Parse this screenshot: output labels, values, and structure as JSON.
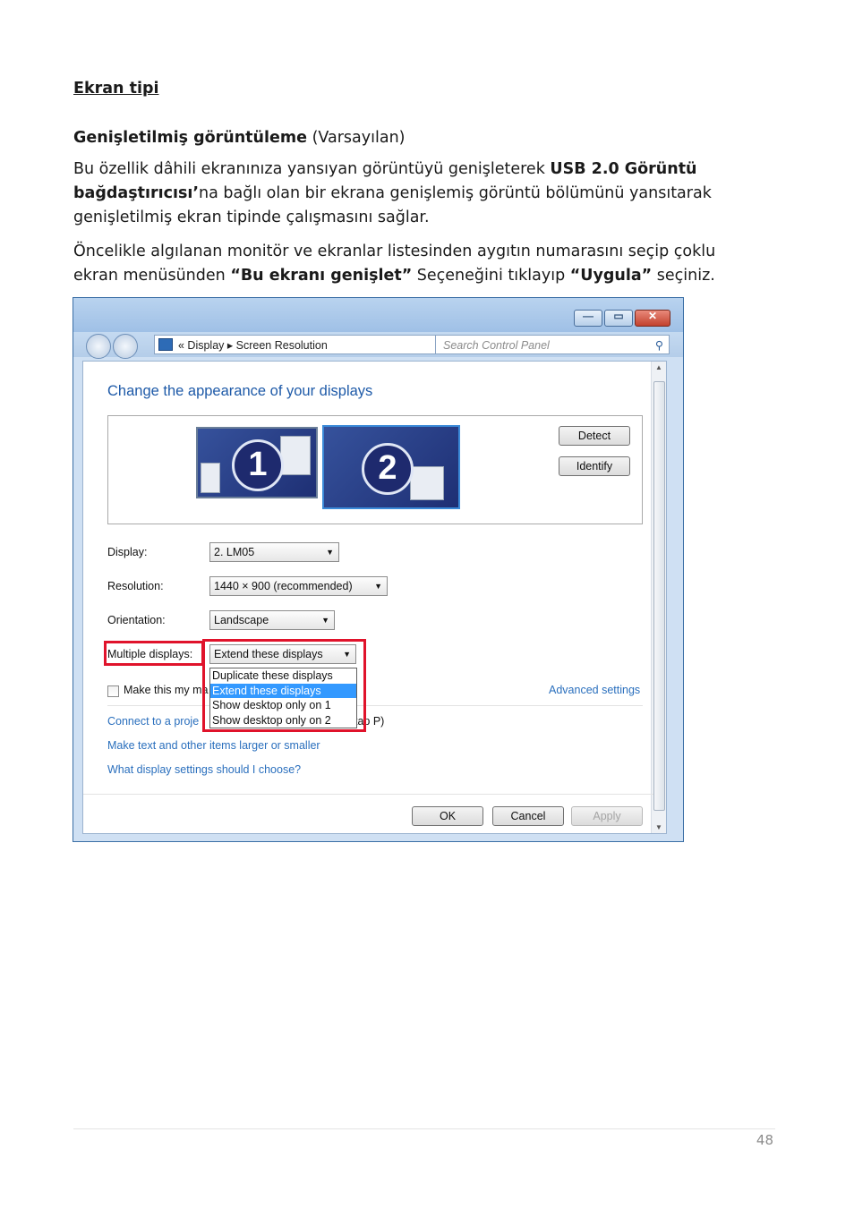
{
  "document": {
    "section_title": "Ekran tipi",
    "subheading_bold": "Genişletilmiş görüntüleme",
    "subheading_rest": "(Varsayılan)",
    "p1_a": "Bu özellik dâhili ekranınıza yansıyan görüntüyü genişleterek",
    "p1_b": "USB 2.0 Görüntü bağdaştırıcısı’",
    "p1_c": "na bağlı olan bir ekrana genişlemiş görüntü bölümünü yansıtarak genişletilmiş ekran tipinde çalışmasını sağlar.",
    "p2_a": "Öncelikle algılanan monitör ve ekranlar listesinden aygıtın numarasını seçip çoklu ekran menüsünden",
    "p2_b": "“Bu ekranı genişlet”",
    "p2_c": "Seçeneğini tıklayıp",
    "p2_d": "“Uygula”",
    "p2_e": "seçiniz.",
    "page_number": "48"
  },
  "window": {
    "breadcrumb": "«  Display  ▸  Screen Resolution",
    "search_placeholder": "Search Control Panel",
    "page_title": "Change the appearance of your displays",
    "monitor_1": "1",
    "monitor_2": "2",
    "detect": "Detect",
    "identify": "Identify",
    "display_label": "Display:",
    "display_value": "2. LM05",
    "resolution_label": "Resolution:",
    "resolution_value": "1440 × 900 (recommended)",
    "orientation_label": "Orientation:",
    "orientation_value": "Landscape",
    "multiple_label": "Multiple displays:",
    "multiple_value": "Extend these displays",
    "options": [
      "Duplicate these displays",
      "Extend these displays",
      "Show desktop only on 1",
      "Show desktop only on 2"
    ],
    "make_main_partial": "Make this my ma",
    "advanced": "Advanced settings",
    "connect_partial": "Connect to a proje",
    "connect_tail": "tap P)",
    "make_text": "Make text and other items larger or smaller",
    "what_settings": "What display settings should I choose?",
    "ok": "OK",
    "cancel": "Cancel",
    "apply": "Apply"
  }
}
